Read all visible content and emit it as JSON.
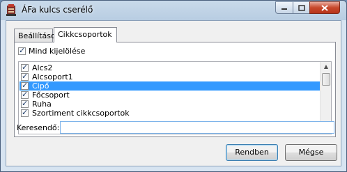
{
  "window": {
    "title": "ÁFa kulcs cserélő"
  },
  "tabs": [
    {
      "label": "Beállítások",
      "active": false
    },
    {
      "label": "Cikkcsoportok",
      "active": true
    }
  ],
  "select_all": {
    "label": "Mind kijelölése",
    "checked": true
  },
  "categories": [
    {
      "label": "Alcs2",
      "checked": true,
      "selected": false
    },
    {
      "label": "Alcsoport1",
      "checked": true,
      "selected": false
    },
    {
      "label": "Cipő",
      "checked": true,
      "selected": true
    },
    {
      "label": "Főcsoport",
      "checked": true,
      "selected": false
    },
    {
      "label": "Ruha",
      "checked": true,
      "selected": false
    },
    {
      "label": "Szortiment cikkcsoportok",
      "checked": true,
      "selected": false
    }
  ],
  "search": {
    "label": "Keresendő:",
    "value": ""
  },
  "buttons": {
    "ok": "Rendben",
    "cancel": "Mégse"
  },
  "colors": {
    "selection": "#3399ff",
    "input_border": "#7eb4ea"
  }
}
